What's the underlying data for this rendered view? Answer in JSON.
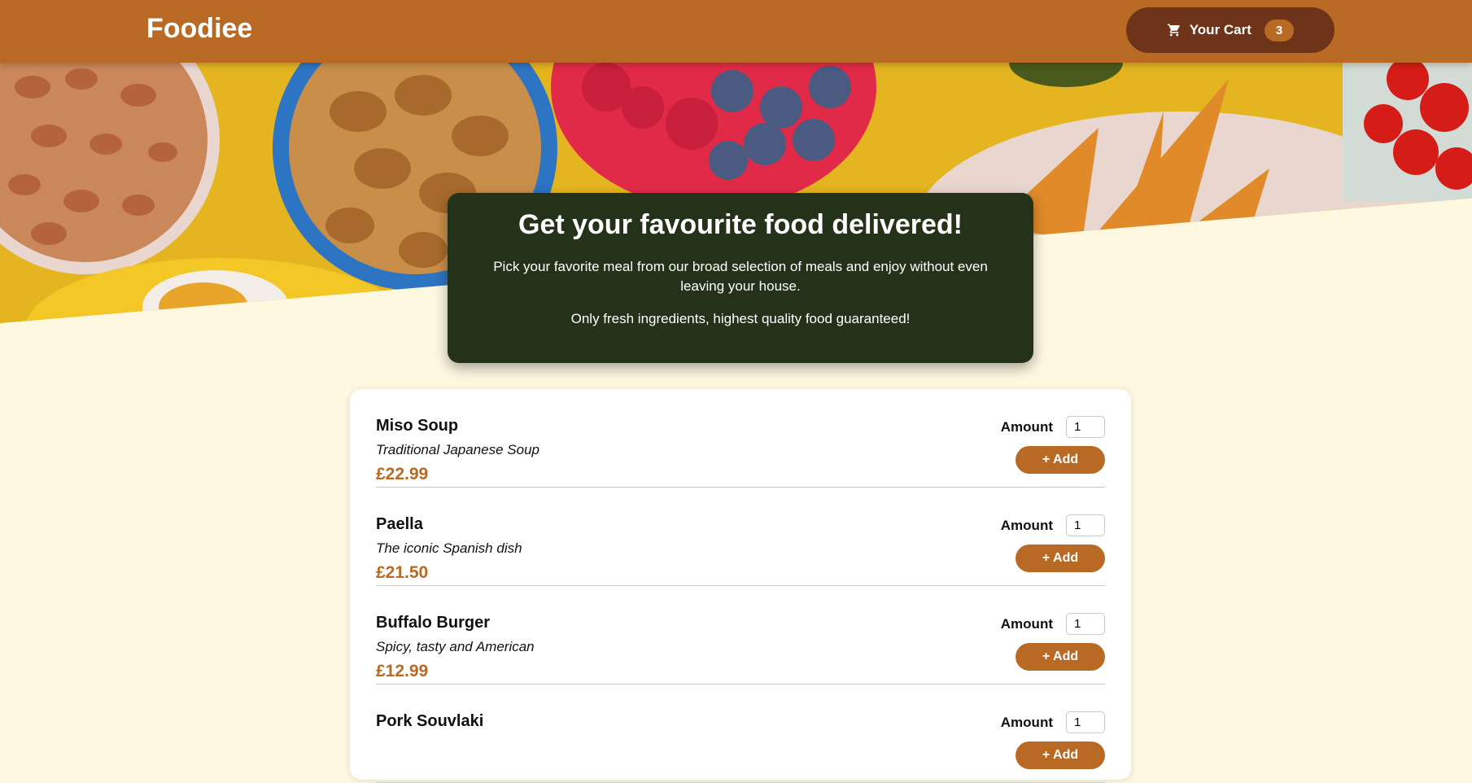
{
  "header": {
    "brand": "Foodiee",
    "cart_label": "Your Cart",
    "cart_count": "3",
    "cart_icon": "cart-icon"
  },
  "hero": {
    "title": "Get your favourite food delivered!",
    "text1": "Pick your favorite meal from our broad selection of meals and enjoy without even leaving your house.",
    "text2": "Only fresh ingredients, highest quality food guaranteed!"
  },
  "meals": [
    {
      "name": "Miso Soup",
      "description": "Traditional Japanese Soup",
      "price": "£22.99",
      "amount_label": "Amount",
      "amount": "1",
      "add_label": "+ Add"
    },
    {
      "name": "Paella",
      "description": "The iconic Spanish dish",
      "price": "£21.50",
      "amount_label": "Amount",
      "amount": "1",
      "add_label": "+ Add"
    },
    {
      "name": "Buffalo Burger",
      "description": "Spicy, tasty and American",
      "price": "£12.99",
      "amount_label": "Amount",
      "amount": "1",
      "add_label": "+ Add"
    },
    {
      "name": "Pork Souvlaki",
      "description": "",
      "price": "",
      "amount_label": "Amount",
      "amount": "1",
      "add_label": "+ Add"
    }
  ],
  "colors": {
    "accent": "#b86a24",
    "cart_button": "#6e3419",
    "intro_bg": "#24321a",
    "page_bg": "#fef8e1"
  }
}
